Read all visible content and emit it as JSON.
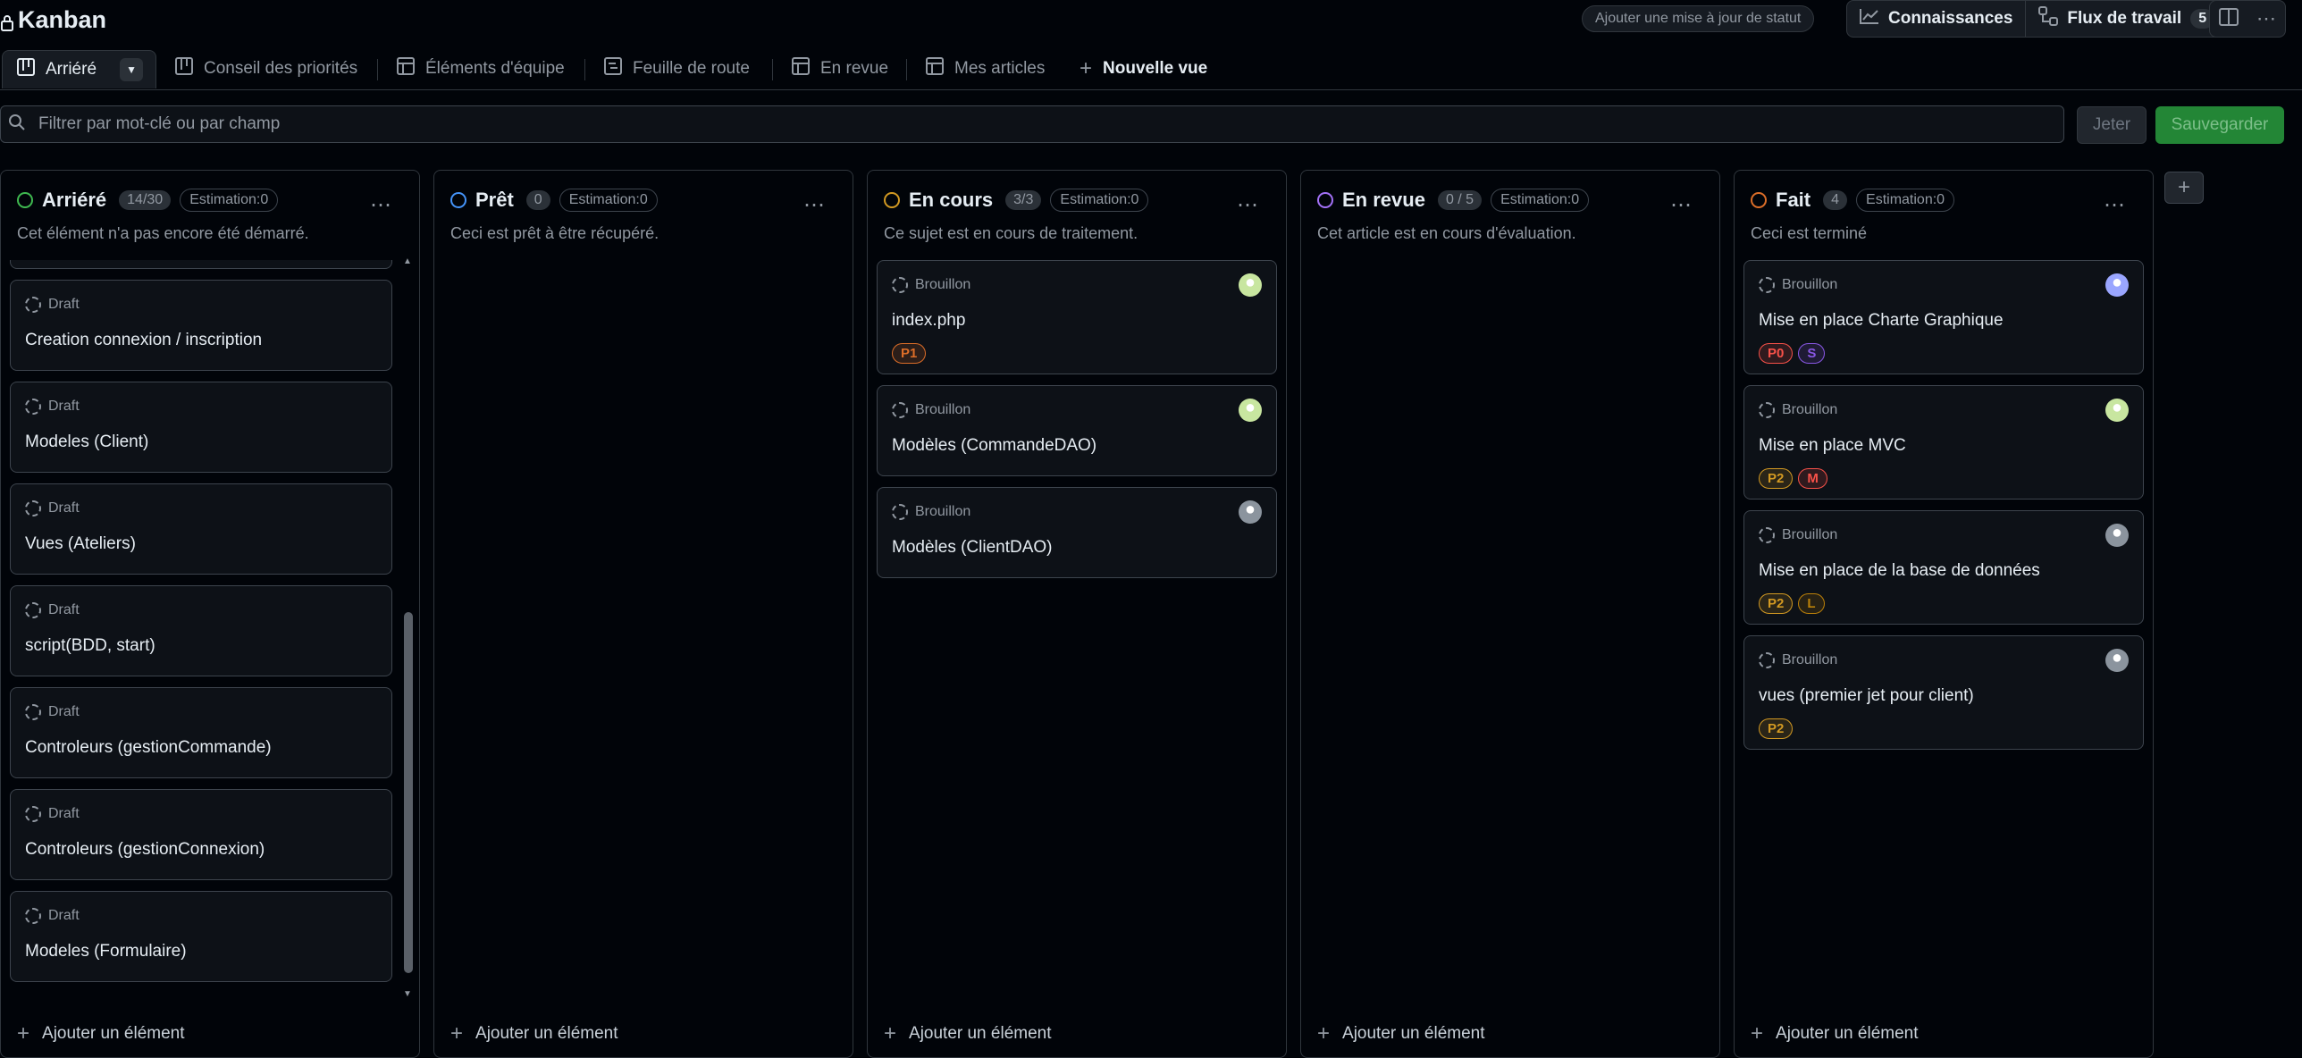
{
  "header": {
    "title": "Kanban",
    "status_update": "Ajouter une mise à jour de statut",
    "insights": "Connaissances",
    "workflows": "Flux de travail",
    "workflows_count": "5"
  },
  "tabs": [
    {
      "label": "Arriéré",
      "icon": "board-icon"
    },
    {
      "label": "Conseil des priorités",
      "icon": "board-icon"
    },
    {
      "label": "Éléments d'équipe",
      "icon": "table-icon"
    },
    {
      "label": "Feuille de route",
      "icon": "roadmap-icon"
    },
    {
      "label": "En revue",
      "icon": "table-icon"
    },
    {
      "label": "Mes articles",
      "icon": "table-icon"
    },
    {
      "label": "Nouvelle vue",
      "icon": "plus-icon"
    }
  ],
  "filter": {
    "placeholder": "Filtrer par mot-clé ou par champ",
    "discard": "Jeter",
    "save": "Sauvegarder"
  },
  "columns": [
    {
      "name": "Arriéré",
      "count": "14/30",
      "estimate": "Estimation:0",
      "description": "Cet élément n'a pas encore été démarré.",
      "color": "#3fb950",
      "add_label": "Ajouter un élément",
      "cards": [
        {
          "status": "Draft",
          "title": "Creation connexion / inscription"
        },
        {
          "status": "Draft",
          "title": "Modeles (Client)"
        },
        {
          "status": "Draft",
          "title": "Vues (Ateliers)"
        },
        {
          "status": "Draft",
          "title": "script(BDD, start)"
        },
        {
          "status": "Draft",
          "title": "Controleurs (gestionCommande)"
        },
        {
          "status": "Draft",
          "title": "Controleurs (gestionConnexion)"
        },
        {
          "status": "Draft",
          "title": "Modeles (Formulaire)"
        }
      ]
    },
    {
      "name": "Prêt",
      "count": "0",
      "estimate": "Estimation:0",
      "description": "Ceci est prêt à être récupéré.",
      "color": "#4493f8",
      "add_label": "Ajouter un élément",
      "cards": []
    },
    {
      "name": "En cours",
      "count": "3/3",
      "estimate": "Estimation:0",
      "description": "Ce sujet est en cours de traitement.",
      "color": "#d29922",
      "add_label": "Ajouter un élément",
      "cards": [
        {
          "status": "Brouillon",
          "title": "index.php",
          "labels": [
            {
              "text": "P1",
              "color": "#db6d28"
            }
          ],
          "avatar": "#c8e6a0"
        },
        {
          "status": "Brouillon",
          "title": "Modèles (CommandeDAO)",
          "avatar": "#c8e6a0"
        },
        {
          "status": "Brouillon",
          "title": "Modèles (ClientDAO)",
          "avatar": "#8b949e"
        }
      ]
    },
    {
      "name": "En revue",
      "count": "0 / 5",
      "estimate": "Estimation:0",
      "description": "Cet article est en cours d'évaluation.",
      "color": "#a371f7",
      "add_label": "Ajouter un élément",
      "cards": []
    },
    {
      "name": "Fait",
      "count": "4",
      "estimate": "Estimation:0",
      "description": "Ceci est terminé",
      "color": "#db6d28",
      "add_label": "Ajouter un élément",
      "cards": [
        {
          "status": "Brouillon",
          "title": "Mise en place Charte Graphique",
          "labels": [
            {
              "text": "P0",
              "color": "#f85149"
            },
            {
              "text": "S",
              "color": "#8957e5"
            }
          ],
          "avatar": "#9aa6ff"
        },
        {
          "status": "Brouillon",
          "title": "Mise en place MVC",
          "labels": [
            {
              "text": "P2",
              "color": "#d29922"
            },
            {
              "text": "M",
              "color": "#f85149"
            }
          ],
          "avatar": "#c8e6a0"
        },
        {
          "status": "Brouillon",
          "title": "Mise en place de la base de données",
          "labels": [
            {
              "text": "P2",
              "color": "#d29922"
            },
            {
              "text": "L",
              "color": "#bb8009"
            }
          ],
          "avatar": "#8b949e"
        },
        {
          "status": "Brouillon",
          "title": "vues (premier jet pour client)",
          "labels": [
            {
              "text": "P2",
              "color": "#d29922"
            }
          ],
          "avatar": "#8b949e"
        }
      ]
    }
  ]
}
